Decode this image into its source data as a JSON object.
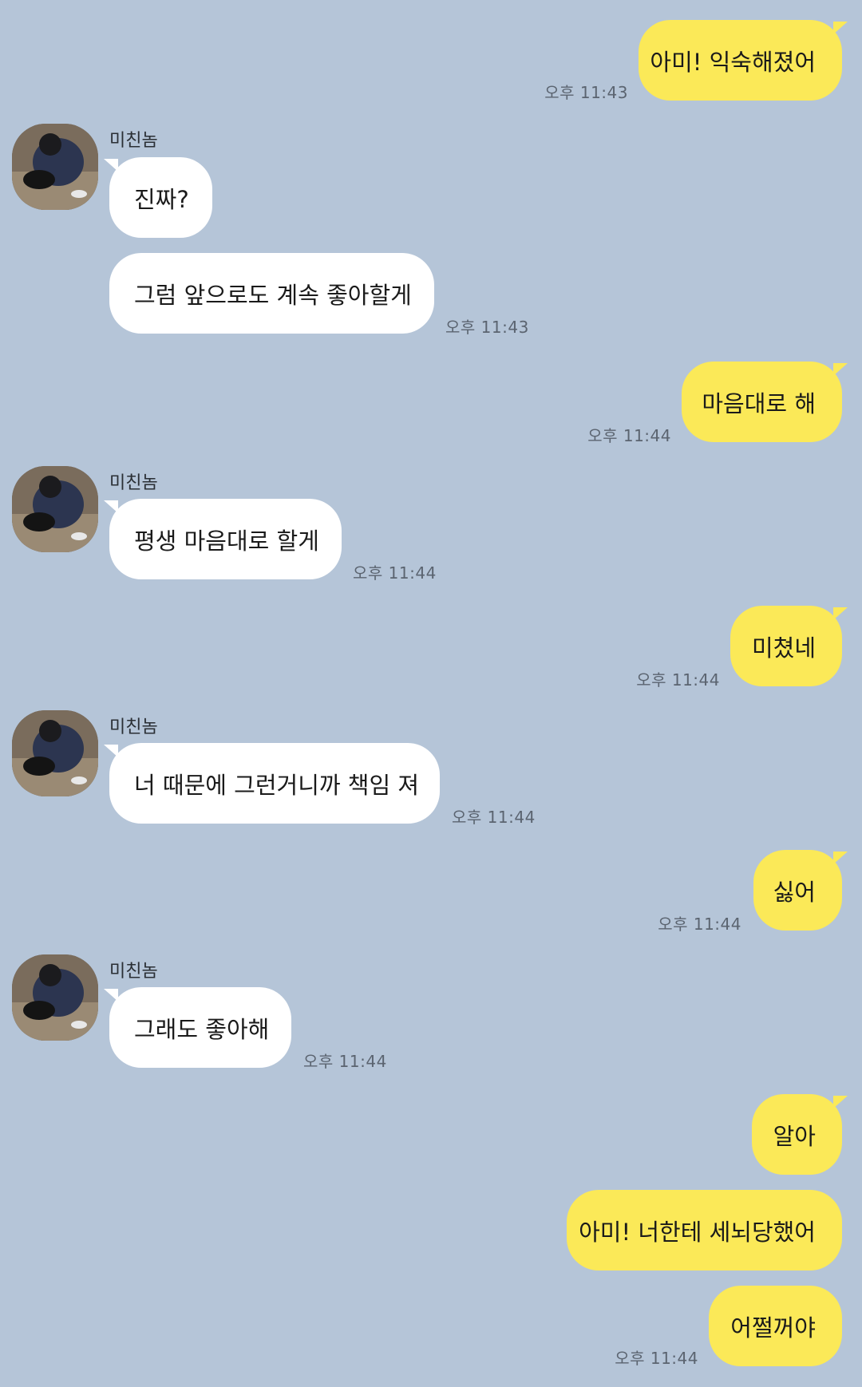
{
  "chat": {
    "partner_name": "미친놈",
    "time_label": "오후",
    "messages": [
      {
        "from": "me",
        "text": "아미! 익숙해졌어",
        "time": "오후 11:43"
      },
      {
        "from": "them",
        "text": "진짜?",
        "time": ""
      },
      {
        "from": "them",
        "text": "그럼 앞으로도 계속 좋아할게",
        "time": "오후 11:43"
      },
      {
        "from": "me",
        "text": "마음대로 해",
        "time": "오후 11:44"
      },
      {
        "from": "them",
        "text": "평생 마음대로 할게",
        "time": "오후 11:44"
      },
      {
        "from": "me",
        "text": "미쳤네",
        "time": "오후 11:44"
      },
      {
        "from": "them",
        "text": "너 때문에 그런거니까 책임 져",
        "time": "오후 11:44"
      },
      {
        "from": "me",
        "text": "싫어",
        "time": "오후 11:44"
      },
      {
        "from": "them",
        "text": "그래도 좋아해",
        "time": "오후 11:44"
      },
      {
        "from": "me",
        "text": "알아",
        "time": ""
      },
      {
        "from": "me",
        "text": "아미! 너한테 세뇌당했어",
        "time": ""
      },
      {
        "from": "me",
        "text": "어쩔꺼야",
        "time": "오후 11:44"
      }
    ]
  },
  "colors": {
    "background": "#b5c5d8",
    "my_bubble": "#fbe958",
    "their_bubble": "#ffffff"
  }
}
